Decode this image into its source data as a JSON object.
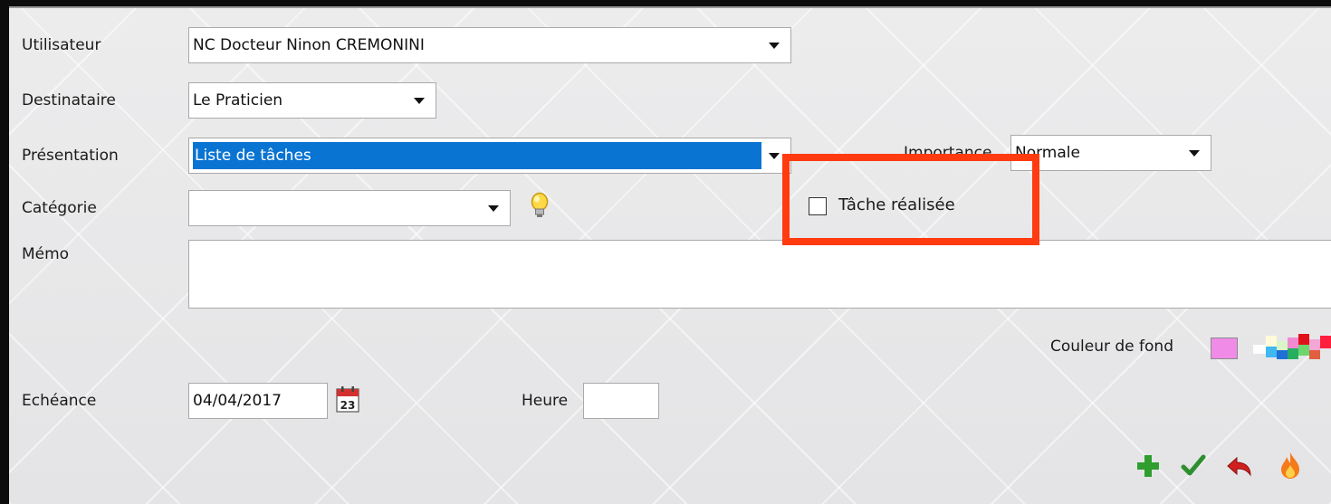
{
  "form": {
    "utilisateur": {
      "label": "Utilisateur",
      "value": "NC Docteur Ninon CREMONINI"
    },
    "destinataire": {
      "label": "Destinataire",
      "value": "Le Praticien"
    },
    "presentation": {
      "label": "Présentation",
      "value": "Liste de tâches"
    },
    "importance": {
      "label": "Importance",
      "value": "Normale"
    },
    "categorie": {
      "label": "Catégorie",
      "value": ""
    },
    "tache_realisee": {
      "label": "Tâche réalisée",
      "checked": false
    },
    "memo": {
      "label": "Mémo",
      "value": ""
    },
    "couleur_fond": {
      "label": "Couleur de fond",
      "selected_color": "#f08ce8"
    },
    "echeance": {
      "label": "Echéance",
      "value": "04/04/2017"
    },
    "heure": {
      "label": "Heure",
      "value": ""
    }
  },
  "calendar_icon_text": "23",
  "highlight_color": "#ff3b0f",
  "icons": [
    "lightbulb-icon",
    "calendar-icon",
    "add-icon",
    "validate-check-icon",
    "undo-icon",
    "flame-icon",
    "color-palette-icon"
  ]
}
